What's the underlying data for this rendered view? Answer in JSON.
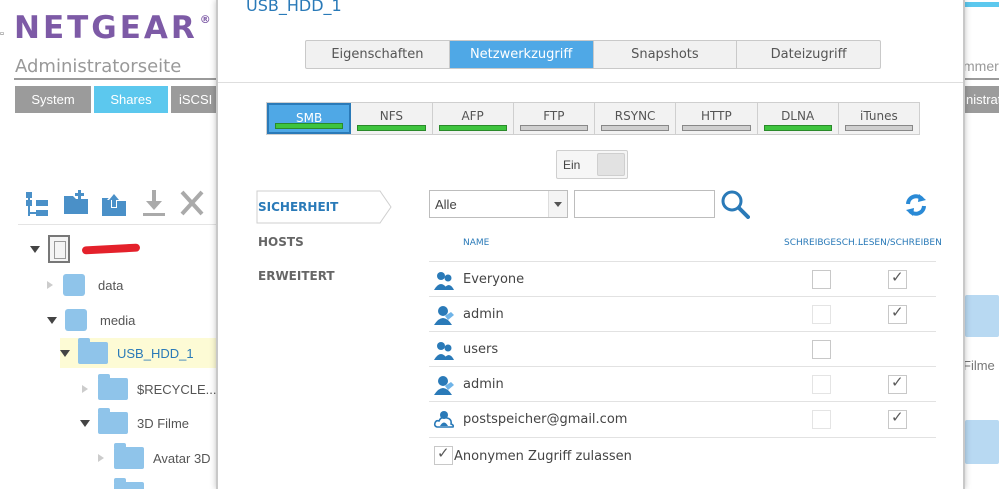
{
  "background": {
    "brand": "NETGEAR",
    "brand_mark": "®",
    "subtitle": "Administratorseite",
    "nav_tabs": [
      {
        "label": "System",
        "active": false
      },
      {
        "label": "Shares",
        "active": true
      },
      {
        "label": "iSCSI",
        "active": false
      }
    ],
    "right_partial_text": "mmer",
    "right_partial_tab": "nistrato",
    "right_partial_folder": "Filme",
    "toolbar_icons": [
      "new-share-icon",
      "new-folder-icon",
      "upload-icon",
      "download-icon",
      "delete-icon"
    ],
    "tree": [
      {
        "label": "",
        "type": "volume",
        "redacted": true
      },
      {
        "label": "data",
        "type": "share"
      },
      {
        "label": "media",
        "type": "share"
      },
      {
        "label": "USB_HDD_1",
        "type": "usb",
        "selected": true
      },
      {
        "label": "$RECYCLE....",
        "type": "folder"
      },
      {
        "label": "3D Filme",
        "type": "folder"
      },
      {
        "label": "Avatar 3D",
        "type": "folder"
      },
      {
        "label": "",
        "type": "folder"
      }
    ]
  },
  "dialog": {
    "title": "USB_HDD_1",
    "tabs": [
      {
        "label": "Eigenschaften",
        "active": false
      },
      {
        "label": "Netzwerkzugriff",
        "active": true
      },
      {
        "label": "Snapshots",
        "active": false
      },
      {
        "label": "Dateizugriff",
        "active": false
      }
    ],
    "protocols": [
      {
        "label": "SMB",
        "active": true,
        "enabled": true
      },
      {
        "label": "NFS",
        "active": false,
        "enabled": true
      },
      {
        "label": "AFP",
        "active": false,
        "enabled": true
      },
      {
        "label": "FTP",
        "active": false,
        "enabled": false
      },
      {
        "label": "RSYNC",
        "active": false,
        "enabled": false
      },
      {
        "label": "HTTP",
        "active": false,
        "enabled": false
      },
      {
        "label": "DLNA",
        "active": false,
        "enabled": true
      },
      {
        "label": "iTunes",
        "active": false,
        "enabled": false
      }
    ],
    "toggle_label": "Ein",
    "side_nav": [
      {
        "label": "SICHERHEIT",
        "active": true
      },
      {
        "label": "HOSTS",
        "active": false
      },
      {
        "label": "ERWEITERT",
        "active": false
      }
    ],
    "filter_select": "Alle",
    "search_value": "",
    "table": {
      "col_name": "NAME",
      "col_readonly": "SCHREIBGESCH...",
      "col_readwrite": "LESEN/SCHREIBEN",
      "rows": [
        {
          "name": "Everyone",
          "kind": "group",
          "readonly": false,
          "readonly_enabled": true,
          "readwrite": true
        },
        {
          "name": "admin",
          "kind": "user",
          "readonly": false,
          "readonly_enabled": false,
          "readwrite": true
        },
        {
          "name": "users",
          "kind": "group",
          "readonly": false,
          "readonly_enabled": true,
          "readwrite": null
        },
        {
          "name": "admin",
          "kind": "user",
          "readonly": false,
          "readonly_enabled": false,
          "readwrite": true
        },
        {
          "name": "postspeicher@gmail.com",
          "kind": "cloud-user",
          "readonly": false,
          "readonly_enabled": false,
          "readwrite": true
        }
      ]
    },
    "anonymous": {
      "label": "Anonymen Zugriff zulassen",
      "checked": true
    }
  },
  "colors": {
    "accent": "#4fa8e6",
    "brand": "#7d5aa6",
    "enabled_indicator": "#3ec43e",
    "link": "#2a7ab8"
  }
}
